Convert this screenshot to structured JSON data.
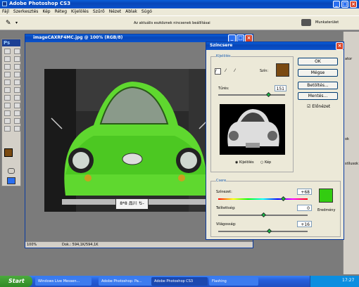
{
  "app": {
    "title": "Adobe Photoshop CS3"
  },
  "menu": [
    "Fájl",
    "Szerkesztés",
    "Kép",
    "Réteg",
    "Kijelölés",
    "Szűrő",
    "Nézet",
    "Ablak",
    "Súgó"
  ],
  "options": {
    "status": "Az aktuális eszköznek nincsenek beállításai",
    "workspace": "Munkaterület"
  },
  "document": {
    "title": "imageCAXRF4MC.jpg @ 100% (RGB/8)",
    "plate": "8*8 品川 ち-",
    "zoom": "100%",
    "doc_info": "Dok.: 594,1K/594,1K"
  },
  "dialog": {
    "title": "Színcsere",
    "selection_group": "Kijelölés",
    "color_label": "Szín:",
    "color": "#7a4a12",
    "tolerance_label": "Tűrés:",
    "tolerance": "151",
    "tolerance_fraction": 0.76,
    "radio_selection": "Kijelölés",
    "radio_image": "Kép",
    "replace_group": "Csere",
    "hue_label": "Színezet:",
    "hue": "+68",
    "saturation_label": "Telítettség:",
    "saturation": "0",
    "lightness_label": "Világosság:",
    "lightness": "+16",
    "result_label": "Eredmény",
    "result_color": "#33cc11",
    "ok": "OK",
    "cancel": "Mégse",
    "load": "Betöltés...",
    "save": "Mentés...",
    "preview": "Előnézet"
  },
  "panels": {
    "labels": [
      "ator",
      "ok",
      "stílusok"
    ]
  },
  "toolbox": {
    "label": "Ps"
  },
  "taskbar": {
    "start": "Start",
    "items": [
      "Windows Live Messen...",
      "Adobe Photoshop: Pa...",
      "Adobe Photoshop CS3",
      "Flashing"
    ],
    "clock": "17:27"
  }
}
